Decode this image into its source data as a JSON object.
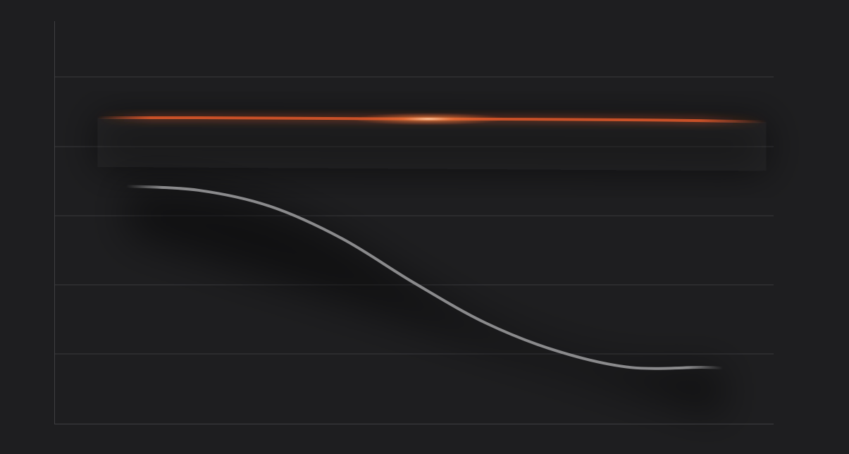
{
  "chart_data": {
    "type": "line",
    "title": "",
    "xlabel": "",
    "ylabel": "",
    "grid": true,
    "legend": "none",
    "xlim": [
      0,
      1
    ],
    "ylim": [
      0,
      1
    ],
    "series": [
      {
        "color": "#e0582a",
        "style": "glowing",
        "x": [
          0.06,
          0.2,
          0.4,
          0.52,
          0.7,
          0.85,
          0.99
        ],
        "y": [
          0.76,
          0.76,
          0.758,
          0.757,
          0.756,
          0.754,
          0.75
        ]
      },
      {
        "color": "#8a8a8c",
        "style": "solid",
        "x": [
          0.1,
          0.2,
          0.3,
          0.4,
          0.5,
          0.6,
          0.7,
          0.8,
          0.9,
          0.93
        ],
        "y": [
          0.59,
          0.58,
          0.54,
          0.46,
          0.35,
          0.25,
          0.18,
          0.14,
          0.14,
          0.138
        ]
      }
    ],
    "colors": {
      "background": "#1e1e20",
      "grid": "#3a3a3d",
      "axis": "#3f3f42",
      "accent": "#e0582a",
      "line": "#8a8a8c"
    }
  }
}
